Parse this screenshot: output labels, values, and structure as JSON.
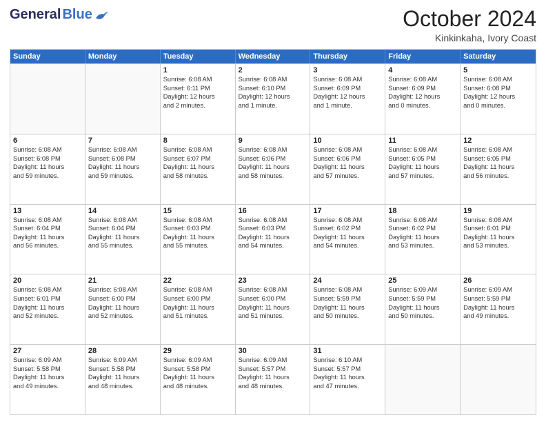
{
  "logo": {
    "general": "General",
    "blue": "Blue"
  },
  "title": "October 2024",
  "subtitle": "Kinkinkaha, Ivory Coast",
  "days": [
    "Sunday",
    "Monday",
    "Tuesday",
    "Wednesday",
    "Thursday",
    "Friday",
    "Saturday"
  ],
  "weeks": [
    [
      {
        "day": "",
        "lines": []
      },
      {
        "day": "",
        "lines": []
      },
      {
        "day": "1",
        "lines": [
          "Sunrise: 6:08 AM",
          "Sunset: 6:11 PM",
          "Daylight: 12 hours",
          "and 2 minutes."
        ]
      },
      {
        "day": "2",
        "lines": [
          "Sunrise: 6:08 AM",
          "Sunset: 6:10 PM",
          "Daylight: 12 hours",
          "and 1 minute."
        ]
      },
      {
        "day": "3",
        "lines": [
          "Sunrise: 6:08 AM",
          "Sunset: 6:09 PM",
          "Daylight: 12 hours",
          "and 1 minute."
        ]
      },
      {
        "day": "4",
        "lines": [
          "Sunrise: 6:08 AM",
          "Sunset: 6:09 PM",
          "Daylight: 12 hours",
          "and 0 minutes."
        ]
      },
      {
        "day": "5",
        "lines": [
          "Sunrise: 6:08 AM",
          "Sunset: 6:08 PM",
          "Daylight: 12 hours",
          "and 0 minutes."
        ]
      }
    ],
    [
      {
        "day": "6",
        "lines": [
          "Sunrise: 6:08 AM",
          "Sunset: 6:08 PM",
          "Daylight: 11 hours",
          "and 59 minutes."
        ]
      },
      {
        "day": "7",
        "lines": [
          "Sunrise: 6:08 AM",
          "Sunset: 6:08 PM",
          "Daylight: 11 hours",
          "and 59 minutes."
        ]
      },
      {
        "day": "8",
        "lines": [
          "Sunrise: 6:08 AM",
          "Sunset: 6:07 PM",
          "Daylight: 11 hours",
          "and 58 minutes."
        ]
      },
      {
        "day": "9",
        "lines": [
          "Sunrise: 6:08 AM",
          "Sunset: 6:06 PM",
          "Daylight: 11 hours",
          "and 58 minutes."
        ]
      },
      {
        "day": "10",
        "lines": [
          "Sunrise: 6:08 AM",
          "Sunset: 6:06 PM",
          "Daylight: 11 hours",
          "and 57 minutes."
        ]
      },
      {
        "day": "11",
        "lines": [
          "Sunrise: 6:08 AM",
          "Sunset: 6:05 PM",
          "Daylight: 11 hours",
          "and 57 minutes."
        ]
      },
      {
        "day": "12",
        "lines": [
          "Sunrise: 6:08 AM",
          "Sunset: 6:05 PM",
          "Daylight: 11 hours",
          "and 56 minutes."
        ]
      }
    ],
    [
      {
        "day": "13",
        "lines": [
          "Sunrise: 6:08 AM",
          "Sunset: 6:04 PM",
          "Daylight: 11 hours",
          "and 56 minutes."
        ]
      },
      {
        "day": "14",
        "lines": [
          "Sunrise: 6:08 AM",
          "Sunset: 6:04 PM",
          "Daylight: 11 hours",
          "and 55 minutes."
        ]
      },
      {
        "day": "15",
        "lines": [
          "Sunrise: 6:08 AM",
          "Sunset: 6:03 PM",
          "Daylight: 11 hours",
          "and 55 minutes."
        ]
      },
      {
        "day": "16",
        "lines": [
          "Sunrise: 6:08 AM",
          "Sunset: 6:03 PM",
          "Daylight: 11 hours",
          "and 54 minutes."
        ]
      },
      {
        "day": "17",
        "lines": [
          "Sunrise: 6:08 AM",
          "Sunset: 6:02 PM",
          "Daylight: 11 hours",
          "and 54 minutes."
        ]
      },
      {
        "day": "18",
        "lines": [
          "Sunrise: 6:08 AM",
          "Sunset: 6:02 PM",
          "Daylight: 11 hours",
          "and 53 minutes."
        ]
      },
      {
        "day": "19",
        "lines": [
          "Sunrise: 6:08 AM",
          "Sunset: 6:01 PM",
          "Daylight: 11 hours",
          "and 53 minutes."
        ]
      }
    ],
    [
      {
        "day": "20",
        "lines": [
          "Sunrise: 6:08 AM",
          "Sunset: 6:01 PM",
          "Daylight: 11 hours",
          "and 52 minutes."
        ]
      },
      {
        "day": "21",
        "lines": [
          "Sunrise: 6:08 AM",
          "Sunset: 6:00 PM",
          "Daylight: 11 hours",
          "and 52 minutes."
        ]
      },
      {
        "day": "22",
        "lines": [
          "Sunrise: 6:08 AM",
          "Sunset: 6:00 PM",
          "Daylight: 11 hours",
          "and 51 minutes."
        ]
      },
      {
        "day": "23",
        "lines": [
          "Sunrise: 6:08 AM",
          "Sunset: 6:00 PM",
          "Daylight: 11 hours",
          "and 51 minutes."
        ]
      },
      {
        "day": "24",
        "lines": [
          "Sunrise: 6:08 AM",
          "Sunset: 5:59 PM",
          "Daylight: 11 hours",
          "and 50 minutes."
        ]
      },
      {
        "day": "25",
        "lines": [
          "Sunrise: 6:09 AM",
          "Sunset: 5:59 PM",
          "Daylight: 11 hours",
          "and 50 minutes."
        ]
      },
      {
        "day": "26",
        "lines": [
          "Sunrise: 6:09 AM",
          "Sunset: 5:59 PM",
          "Daylight: 11 hours",
          "and 49 minutes."
        ]
      }
    ],
    [
      {
        "day": "27",
        "lines": [
          "Sunrise: 6:09 AM",
          "Sunset: 5:58 PM",
          "Daylight: 11 hours",
          "and 49 minutes."
        ]
      },
      {
        "day": "28",
        "lines": [
          "Sunrise: 6:09 AM",
          "Sunset: 5:58 PM",
          "Daylight: 11 hours",
          "and 48 minutes."
        ]
      },
      {
        "day": "29",
        "lines": [
          "Sunrise: 6:09 AM",
          "Sunset: 5:58 PM",
          "Daylight: 11 hours",
          "and 48 minutes."
        ]
      },
      {
        "day": "30",
        "lines": [
          "Sunrise: 6:09 AM",
          "Sunset: 5:57 PM",
          "Daylight: 11 hours",
          "and 48 minutes."
        ]
      },
      {
        "day": "31",
        "lines": [
          "Sunrise: 6:10 AM",
          "Sunset: 5:57 PM",
          "Daylight: 11 hours",
          "and 47 minutes."
        ]
      },
      {
        "day": "",
        "lines": []
      },
      {
        "day": "",
        "lines": []
      }
    ]
  ]
}
